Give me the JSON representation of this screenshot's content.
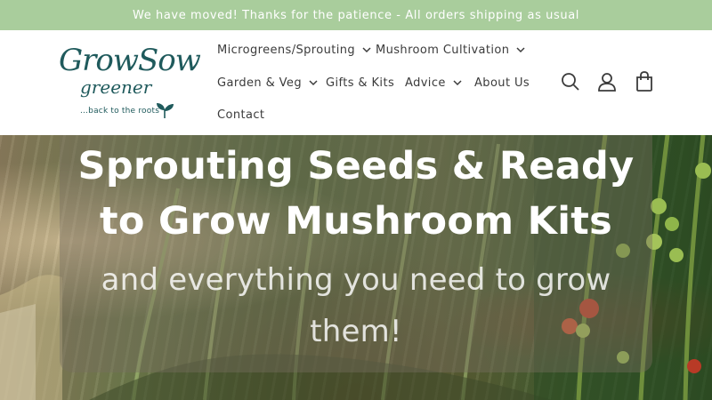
{
  "announcement": {
    "text": "We have moved! Thanks for the patience - All orders shipping as usual"
  },
  "logo": {
    "script": "GrowSow",
    "sub": "greener",
    "tagline": "...back to the roots"
  },
  "nav": {
    "items": [
      {
        "label": "Microgreens/Sprouting",
        "has_dropdown": true
      },
      {
        "label": "Mushroom Cultivation",
        "has_dropdown": true
      },
      {
        "label": "Garden & Veg",
        "has_dropdown": true
      },
      {
        "label": "Gifts & Kits",
        "has_dropdown": false
      },
      {
        "label": "Advice",
        "has_dropdown": true
      },
      {
        "label": "About Us",
        "has_dropdown": false
      },
      {
        "label": "Contact",
        "has_dropdown": false
      }
    ]
  },
  "header_icons": [
    "search-icon",
    "account-icon",
    "cart-icon"
  ],
  "hero": {
    "title": "Sprouting Seeds & Ready to Grow Mushroom Kits",
    "subtitle": "and everything you need to grow them!"
  },
  "colors": {
    "announcement_bg": "#a9cd9c",
    "brand_teal": "#1f5a5c",
    "nav_text": "#3b3b3b"
  }
}
